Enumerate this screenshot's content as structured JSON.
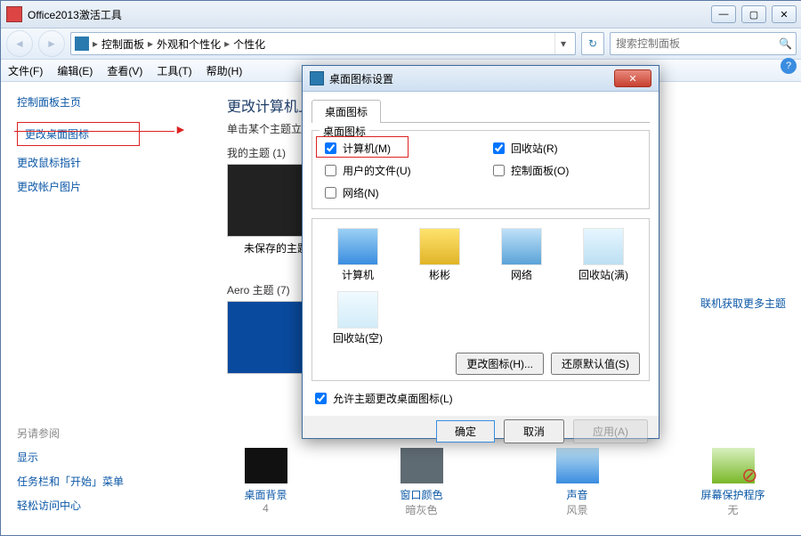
{
  "window": {
    "title": "Office2013激活工具"
  },
  "nav": {
    "breadcrumb": [
      "控制面板",
      "外观和个性化",
      "个性化"
    ]
  },
  "search": {
    "placeholder": "搜索控制面板"
  },
  "menu": {
    "file": "文件(F)",
    "edit": "编辑(E)",
    "view": "查看(V)",
    "tools": "工具(T)",
    "help": "帮助(H)"
  },
  "sidebar": {
    "cp_home": "控制面板主页",
    "links": {
      "desktop_icons": "更改桌面图标",
      "mouse_pointers": "更改鼠标指针",
      "account_picture": "更改帐户图片"
    },
    "see_also": {
      "header": "另请参阅",
      "display": "显示",
      "taskbar": "任务栏和「开始」菜单",
      "ease": "轻松访问中心"
    }
  },
  "main": {
    "heading": "更改计算机上的视觉效果和声音",
    "subtitle": "单击某个主题立即更改桌面背景、窗口颜色、声音和屏幕保护程序。",
    "my_themes": "我的主题 (1)",
    "unsaved_theme": "未保存的主题",
    "aero_themes": "Aero 主题 (7)",
    "online_link": "联机获取更多主题"
  },
  "bottom": {
    "bg": {
      "label": "桌面背景",
      "value": "4"
    },
    "color": {
      "label": "窗口颜色",
      "value": "暗灰色"
    },
    "sound": {
      "label": "声音",
      "value": "风景"
    },
    "scr": {
      "label": "屏幕保护程序",
      "value": "无"
    }
  },
  "dialog": {
    "title": "桌面图标设置",
    "tab": "桌面图标",
    "group_label": "桌面图标",
    "checkboxes": {
      "computer": {
        "label": "计算机(M)",
        "checked": true
      },
      "recycle": {
        "label": "回收站(R)",
        "checked": true
      },
      "userfiles": {
        "label": "用户的文件(U)",
        "checked": false
      },
      "cpanel": {
        "label": "控制面板(O)",
        "checked": false
      },
      "network": {
        "label": "网络(N)",
        "checked": false
      }
    },
    "icons": {
      "computer": "计算机",
      "user": "彬彬",
      "network": "网络",
      "rb_full": "回收站(满)",
      "rb_empty": "回收站(空)"
    },
    "change_icon": "更改图标(H)...",
    "restore_default": "还原默认值(S)",
    "allow_theme": "允许主题更改桌面图标(L)",
    "allow_theme_checked": true,
    "ok": "确定",
    "cancel": "取消",
    "apply": "应用(A)"
  }
}
